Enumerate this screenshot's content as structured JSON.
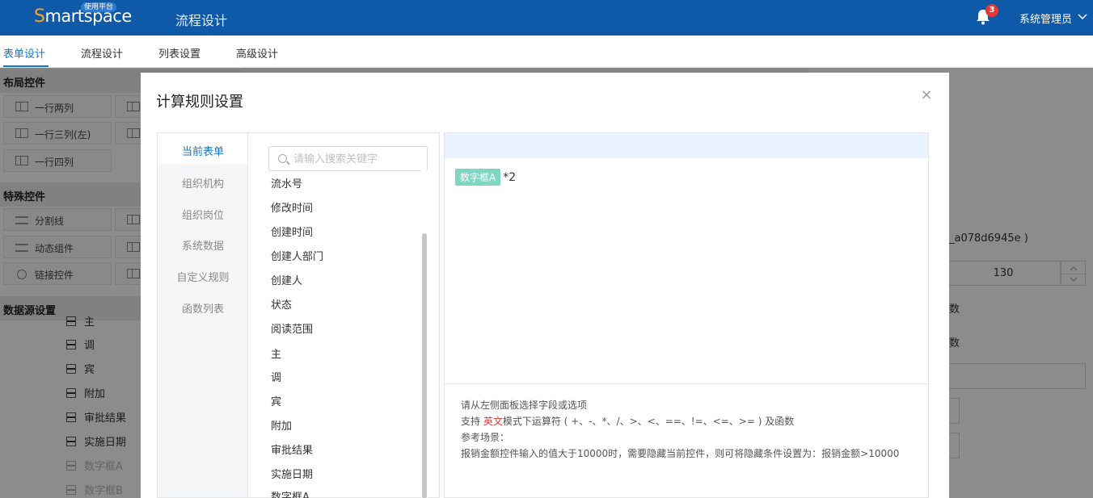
{
  "topbar": {
    "logo_first": "S",
    "logo_rest": "martspace",
    "logo_badge": "使用平台",
    "title": "流程设计",
    "notification_count": "3",
    "user": "系统管理员"
  },
  "tabs": [
    "表单设计",
    "流程设计",
    "列表设置",
    "高级设计"
  ],
  "palette": {
    "layout_title": "布局控件",
    "layout_items": [
      "一行两列",
      "一行三列(左)",
      "一行四列"
    ],
    "special_title": "特殊控件",
    "special_items": [
      "分割线",
      "动态组件",
      "链接控件"
    ],
    "datasource_title": "数据源设置",
    "datasource_items": [
      "主",
      "调",
      "宾",
      "附加",
      "审批结果",
      "实施日期",
      "数字框A",
      "数字框B"
    ]
  },
  "props": {
    "id_suffix": "_a078d6945e )",
    "number_value": "130",
    "text1": "数",
    "text2": "数"
  },
  "modal": {
    "title": "计算规则设置",
    "close": "×",
    "nav": [
      "当前表单",
      "组织机构",
      "组织岗位",
      "系统数据",
      "自定义规则",
      "函数列表"
    ],
    "search_placeholder": "请输入搜索关键字",
    "fields": [
      "流水号",
      "修改时间",
      "创建时间",
      "创建人部门",
      "创建人",
      "状态",
      "阅读范围",
      "主",
      "调",
      "宾",
      "附加",
      "审批结果",
      "实施日期",
      "数字框A"
    ],
    "formula_chip": "数字框A",
    "formula_rest": "*2",
    "hints": {
      "line1": "请从左侧面板选择字段或选项",
      "line2_pre": "支持 ",
      "line2_red": "英文",
      "line2_post": "模式下运算符 ( +、-、*、/、>、<、==、!=、<=、>= ) 及函数",
      "line3": "参考场景：",
      "line4": "报销金额控件输入的值大于10000时，需要隐藏当前控件，则可将隐藏条件设置为：报销金额>10000"
    }
  }
}
